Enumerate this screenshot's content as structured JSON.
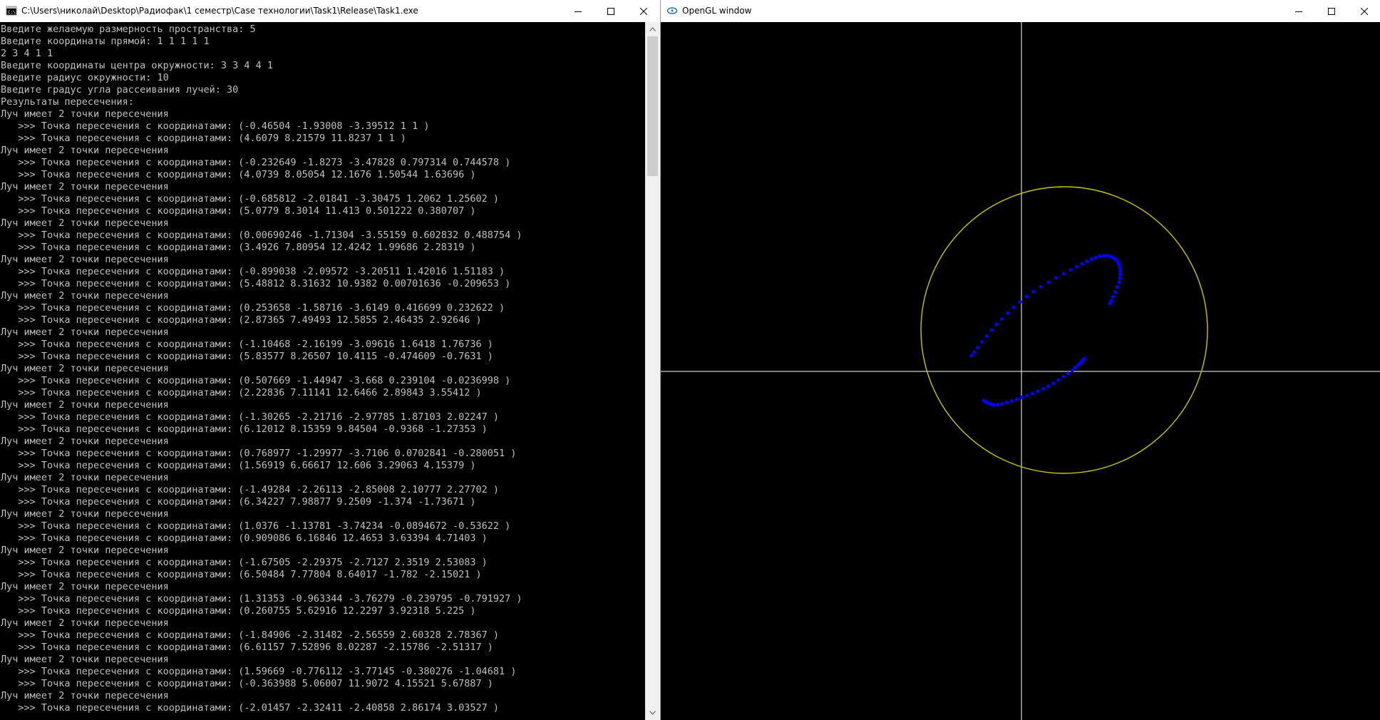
{
  "console": {
    "title": "C:\\Users\\николай\\Desktop\\Радиофак\\1 семестр\\Case технологии\\Task1\\Release\\Task1.exe",
    "lines": [
      "Введите желаемую размерность пространства: 5",
      "Введите координаты прямой: 1 1 1 1 1",
      "2 3 4 1 1",
      "Введите координаты центра окружности: 3 3 4 4 1",
      "Введите радиус окружности: 10",
      "Введите градус угла рассеивания лучей: 30",
      "Результаты пересечения:",
      "Луч имеет 2 точки пересечения",
      "   >>> Точка пересечения с координатами: (-0.46504 -1.93008 -3.39512 1 1 )",
      "   >>> Точка пересечения с координатами: (4.6079 8.21579 11.8237 1 1 )",
      "Луч имеет 2 точки пересечения",
      "   >>> Точка пересечения с координатами: (-0.232649 -1.8273 -3.47828 0.797314 0.744578 )",
      "   >>> Точка пересечения с координатами: (4.0739 8.05054 12.1676 1.50544 1.63696 )",
      "Луч имеет 2 точки пересечения",
      "   >>> Точка пересечения с координатами: (-0.685812 -2.01841 -3.30475 1.2062 1.25602 )",
      "   >>> Точка пересечения с координатами: (5.0779 8.3014 11.413 0.501222 0.380707 )",
      "Луч имеет 2 точки пересечения",
      "   >>> Точка пересечения с координатами: (0.00690246 -1.71304 -3.55159 0.602832 0.488754 )",
      "   >>> Точка пересечения с координатами: (3.4926 7.80954 12.4242 1.99686 2.28319 )",
      "Луч имеет 2 точки пересечения",
      "   >>> Точка пересечения с координатами: (-0.899038 -2.09572 -3.20511 1.42016 1.51183 )",
      "   >>> Точка пересечения с координатами: (5.48812 8.31632 10.9382 0.00701636 -0.209653 )",
      "Луч имеет 2 точки пересечения",
      "   >>> Точка пересечения с координатами: (0.253658 -1.58716 -3.6149 0.416699 0.232622 )",
      "   >>> Точка пересечения с координатами: (2.87365 7.49493 12.5855 2.46435 2.92646 )",
      "Луч имеет 2 точки пересечения",
      "   >>> Точка пересечения с координатами: (-1.10468 -2.16199 -3.09616 1.6418 1.76736 )",
      "   >>> Точка пересечения с координатами: (5.83577 8.26507 10.4115 -0.474609 -0.7631 )",
      "Луч имеет 2 точки пересечения",
      "   >>> Точка пересечения с координатами: (0.507669 -1.44947 -3.668 0.239104 -0.0236998 )",
      "   >>> Точка пересечения с координатами: (2.22836 7.11141 12.6466 2.89843 3.55412 )",
      "Луч имеет 2 точки пересечения",
      "   >>> Точка пересечения с координатами: (-1.30265 -2.21716 -2.97785 1.87103 2.02247 )",
      "   >>> Точка пересечения с координатами: (6.12012 8.15359 9.84504 -0.9368 -1.27353 )",
      "Луч имеет 2 точки пересечения",
      "   >>> Точка пересечения с координатами: (0.768977 -1.29977 -3.7106 0.0702841 -0.280051 )",
      "   >>> Точка пересечения с координатами: (1.56919 6.66617 12.606 3.29063 4.15379 )",
      "Луч имеет 2 точки пересечения",
      "   >>> Точка пересечения с координатами: (-1.49284 -2.26113 -2.85008 2.10777 2.27702 )",
      "   >>> Точка пересечения с координатами: (6.34227 7.98877 9.2509 -1.374 -1.73671 )",
      "Луч имеет 2 точки пересечения",
      "   >>> Точка пересечения с координатами: (1.0376 -1.13781 -3.74234 -0.0894672 -0.53622 )",
      "   >>> Точка пересечения с координатами: (0.909086 6.16846 12.4653 3.63394 4.71403 )",
      "Луч имеет 2 точки пересечения",
      "   >>> Точка пересечения с координатами: (-1.67505 -2.29375 -2.7127 2.3519 2.53083 )",
      "   >>> Точка пересечения с координатами: (6.50484 7.77804 8.64017 -1.782 -2.15021 )",
      "Луч имеет 2 точки пересечения",
      "   >>> Точка пересечения с координатами: (1.31353 -0.963344 -3.76279 -0.239795 -0.791927 )",
      "   >>> Точка пересечения с координатами: (0.260755 5.62916 12.2297 3.92318 5.225 )",
      "Луч имеет 2 точки пересечения",
      "   >>> Точка пересечения с координатами: (-1.84906 -2.31482 -2.56559 2.60328 2.78367 )",
      "   >>> Точка пересечения с координатами: (6.61157 7.52896 8.02287 -2.15786 -2.51317 )",
      "Луч имеет 2 точки пересечения",
      "   >>> Точка пересечения с координатами: (1.59669 -0.776112 -3.77145 -0.380276 -1.04681 )",
      "   >>> Точка пересечения с координатами: (-0.363988 5.06007 11.9072 4.15521 5.67887 )",
      "Луч имеет 2 точки пересечения",
      "   >>> Точка пересечения с координатами: (-2.01457 -2.32411 -2.40858 2.86174 3.03527 )"
    ]
  },
  "gl_window": {
    "title": "OpenGL window",
    "colors": {
      "background": "#000000",
      "axes": "#ffffff",
      "circle": "#c8c800",
      "points": "#0000ff"
    }
  },
  "icons": {
    "minimize": "minimize-icon",
    "maximize": "maximize-icon",
    "close": "close-icon"
  }
}
